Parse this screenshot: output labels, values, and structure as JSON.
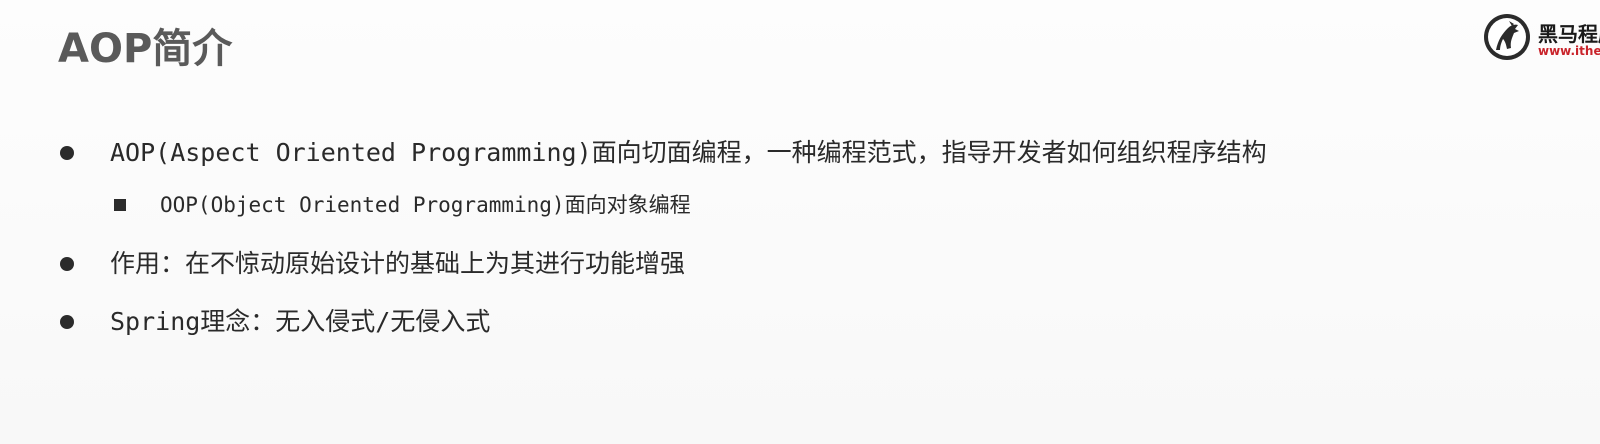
{
  "slide": {
    "title": "AOP简介",
    "logo": {
      "name": "黑马程序员",
      "url": "www.itheima.com"
    },
    "bullets": [
      {
        "level": 1,
        "marker": "dot",
        "text": "AOP(Aspect Oriented Programming)面向切面编程，一种编程范式，指导开发者如何组织程序结构"
      },
      {
        "level": 2,
        "marker": "square",
        "text": "OOP(Object Oriented Programming)面向对象编程"
      },
      {
        "level": 1,
        "marker": "dot",
        "text": "作用：在不惊动原始设计的基础上为其进行功能增强"
      },
      {
        "level": 1,
        "marker": "dot",
        "text": "Spring理念：无入侵式/无侵入式"
      }
    ]
  },
  "colors": {
    "title": "#5a5a5a",
    "text": "#2a2a2a",
    "brand_red": "#c9242b"
  }
}
